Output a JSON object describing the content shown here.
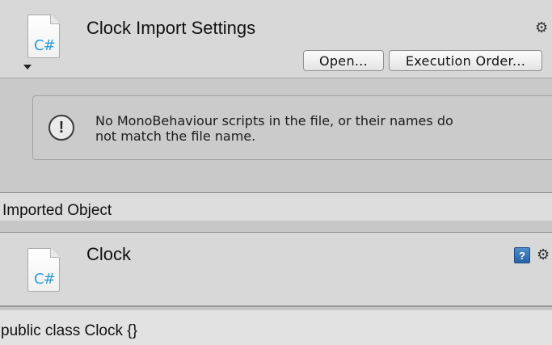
{
  "header": {
    "title": "Clock Import Settings",
    "file_icon_label": "C#",
    "open_button": "Open...",
    "execution_order_button": "Execution Order...",
    "gear_icon": "gear-icon"
  },
  "warning": {
    "icon": "exclamation-icon",
    "line1": "No MonoBehaviour scripts in the file, or their names do",
    "line2": "not match the file name."
  },
  "imported_section": {
    "label": "Imported Object"
  },
  "imported_object": {
    "name": "Clock",
    "file_icon_label": "C#",
    "help_icon_label": "?",
    "gear_icon": "gear-icon"
  },
  "code_preview": {
    "text": "public class Clock {}"
  },
  "colors": {
    "csharp_blue": "#2e9cd6",
    "help_blue": "#2663a6"
  }
}
